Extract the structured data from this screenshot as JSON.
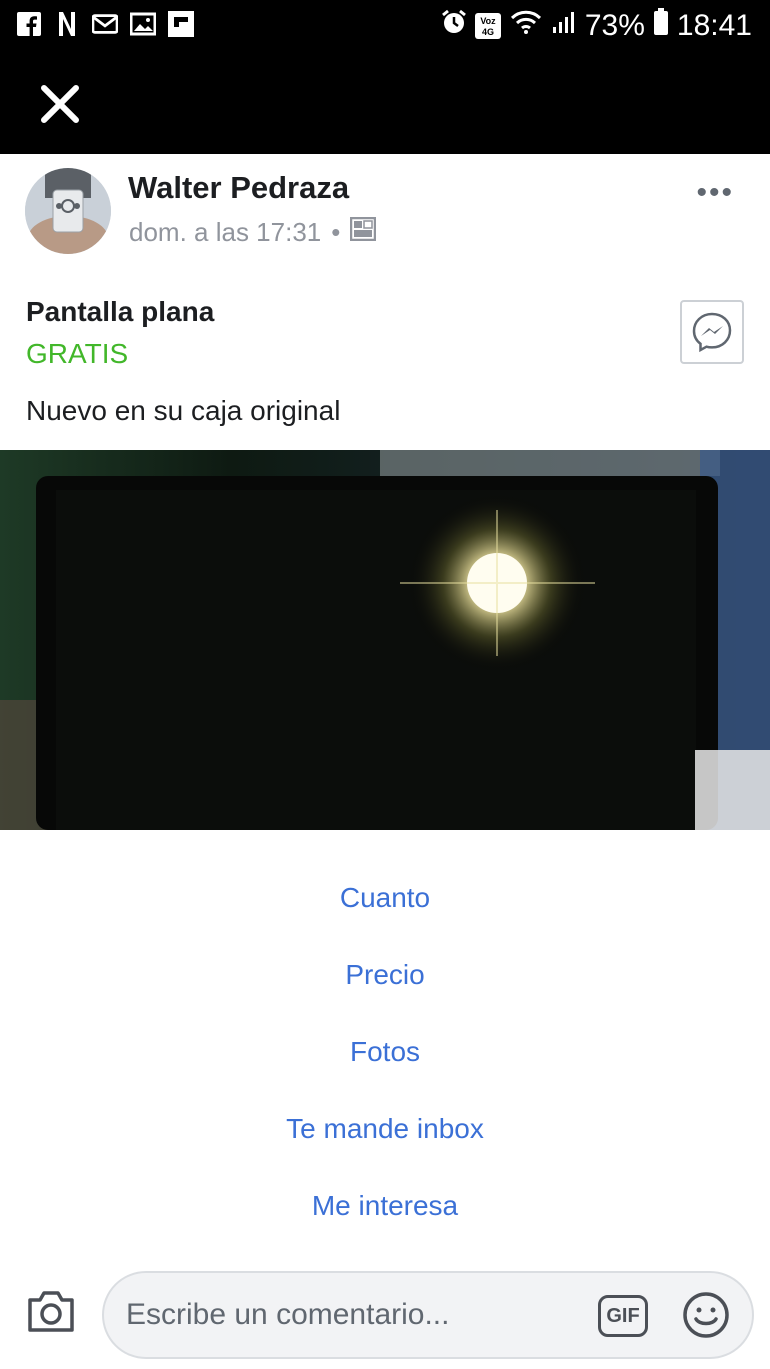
{
  "status_bar": {
    "left_icons": [
      "facebook-icon",
      "netflix-icon",
      "mail-icon",
      "gallery-icon",
      "flipboard-icon"
    ],
    "right_icons": [
      "alarm-icon",
      "volte-icon",
      "wifi-icon",
      "signal-icon",
      "battery-icon"
    ],
    "volte_label": "Voz 4G",
    "battery": "73%",
    "time": "18:41"
  },
  "post": {
    "author": "Walter Pedraza",
    "timestamp": "dom. a las 17:31",
    "separator": "•",
    "visibility_icon": "marketplace-icon",
    "title": "Pantalla plana",
    "price": "GRATIS",
    "description": "Nuevo en su caja original",
    "more_label": "•••"
  },
  "suggestions": [
    "Cuanto",
    "Precio",
    "Fotos",
    "Te mande inbox",
    "Me interesa"
  ],
  "composer": {
    "placeholder": "Escribe un comentario...",
    "gif_label": "GIF"
  },
  "colors": {
    "price_green": "#42b72a",
    "link_blue": "#3b70d6",
    "status_bar_bg": "#000000"
  }
}
